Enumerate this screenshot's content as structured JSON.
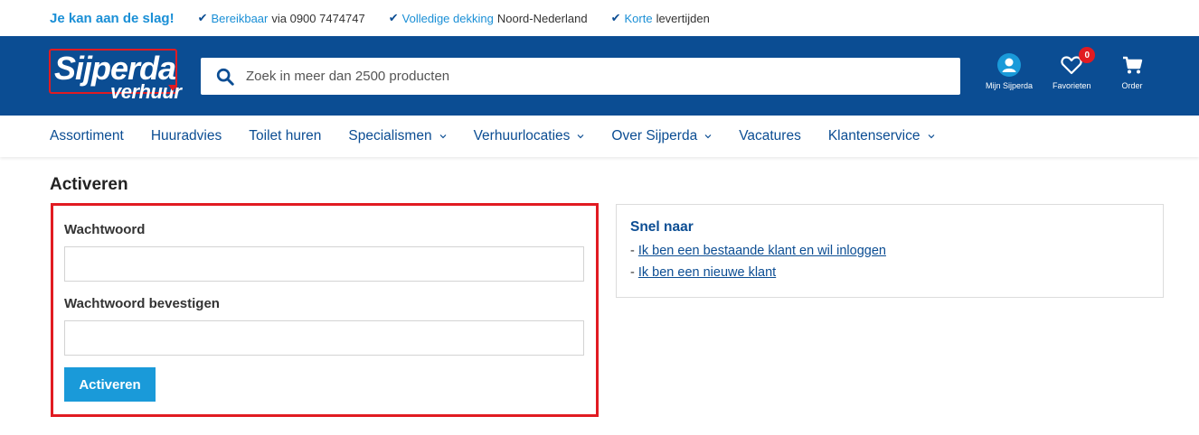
{
  "usp": {
    "slogan": "Je kan aan de slag!",
    "items": [
      {
        "link": "Bereikbaar",
        "text": "via 0900 7474747"
      },
      {
        "link": "Volledige dekking",
        "text": "Noord-Nederland"
      },
      {
        "link": "Korte",
        "text": "levertijden"
      }
    ]
  },
  "logo": {
    "top": "Sijperda",
    "bottom": "verhuur"
  },
  "search": {
    "placeholder": "Zoek in meer dan 2500 producten"
  },
  "header_actions": {
    "account_label": "Mijn Sijperda",
    "favorites_label": "Favorieten",
    "favorites_count": "0",
    "order_label": "Order"
  },
  "nav": {
    "items": [
      {
        "label": "Assortiment"
      },
      {
        "label": "Huuradvies"
      },
      {
        "label": "Toilet huren"
      },
      {
        "label": "Specialismen"
      },
      {
        "label": "Verhuurlocaties"
      },
      {
        "label": "Over Sijperda"
      },
      {
        "label": "Vacatures"
      },
      {
        "label": "Klantenservice"
      }
    ]
  },
  "page": {
    "title": "Activeren"
  },
  "form": {
    "password_label": "Wachtwoord",
    "password_value": "",
    "confirm_label": "Wachtwoord bevestigen",
    "confirm_value": "",
    "submit_label": "Activeren"
  },
  "quick_links": {
    "title": "Snel naar",
    "prefix": "- ",
    "existing_customer": "Ik ben een bestaande klant en wil inloggen",
    "new_customer": "Ik ben een nieuwe klant"
  },
  "colors": {
    "brand_blue": "#0b4d93",
    "accent_blue": "#1a9ad9",
    "highlight_red": "#e11b22"
  }
}
